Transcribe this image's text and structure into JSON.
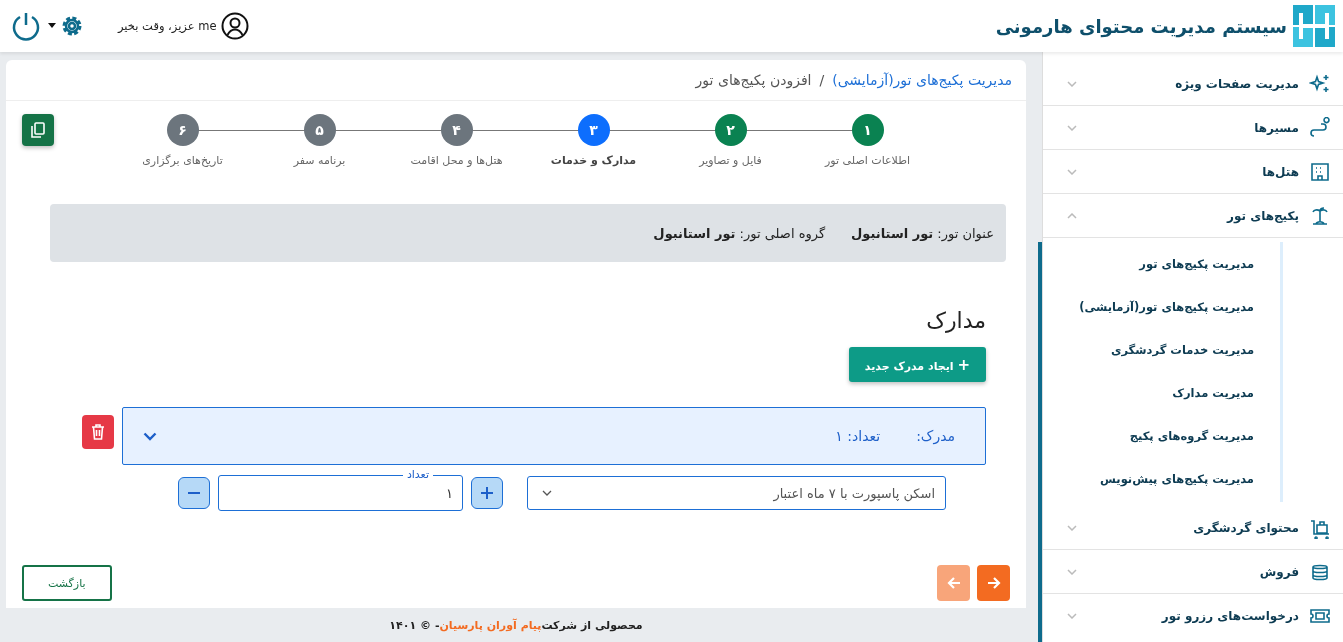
{
  "header": {
    "title": "سیستم مدیریت محتوای هارمونی",
    "greeting": "me عزیز، وقت بخیر"
  },
  "sidebar": {
    "items": [
      {
        "label": "مدیریت صفحات ویژه",
        "expanded": false
      },
      {
        "label": "مسیرها",
        "expanded": false
      },
      {
        "label": "هتل‌ها",
        "expanded": false
      },
      {
        "label": "پکیج‌های تور",
        "expanded": true,
        "children": [
          "مدیریت پکیج‌های تور",
          "مدیریت پکیج‌های تور(آزمایشی)",
          "مدیریت خدمات گردشگری",
          "مدیریت مدارک",
          "مدیریت گروه‌های پکیج",
          "مدیریت پکیج‌های پیش‌نویس"
        ]
      },
      {
        "label": "محتوای گردشگری",
        "expanded": false
      },
      {
        "label": "فروش",
        "expanded": false
      },
      {
        "label": "درخواست‌های رزرو تور",
        "expanded": false
      }
    ]
  },
  "breadcrumb": {
    "link": "مدیریت پکیج‌های تور(آزمایشی)",
    "separator": "/",
    "current": "افزودن پکیج‌های تور"
  },
  "steps": [
    {
      "number": "۱",
      "label": "اطلاعات اصلی تور",
      "kind": "done"
    },
    {
      "number": "۲",
      "label": "فایل و تصاویر",
      "kind": "done"
    },
    {
      "number": "۳",
      "label": "مدارک و خدمات",
      "kind": "active"
    },
    {
      "number": "۴",
      "label": "هتل‌ها و محل اقامت",
      "kind": "pending"
    },
    {
      "number": "۵",
      "label": "برنامه سفر",
      "kind": "pending"
    },
    {
      "number": "۶",
      "label": "تاریخ‌های برگزاری",
      "kind": "pending"
    }
  ],
  "info": [
    {
      "label": "عنوان تور:",
      "value": "تور استانبول"
    },
    {
      "label": "گروه اصلی تور:",
      "value": "تور استانبول"
    }
  ],
  "documents": {
    "title": "مدارک",
    "add_button": {
      "icon": "+",
      "label": "ایجاد مدرک جدید"
    },
    "items": [
      {
        "heading": "مدرک:",
        "count": "تعداد: ۱",
        "expanded": true,
        "document": "اسکن پاسپورت با ۷ ماه اعتبار",
        "quantity_label": "تعداد",
        "quantity": "۱"
      }
    ]
  },
  "nav": {
    "next_disabled": false,
    "prev_disabled": true,
    "back": "بازگشت"
  },
  "footer": {
    "prefix": "محصولی از شرکت",
    "company": "پیام آوران پارسیان",
    "suffix": "- © ۱۴۰۱"
  }
}
